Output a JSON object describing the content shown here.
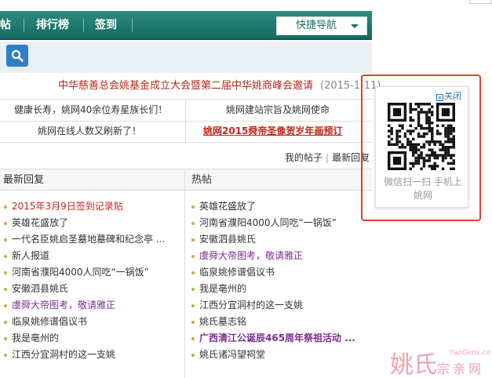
{
  "nav": {
    "items": [
      "帖",
      "排行榜",
      "签到"
    ],
    "quick_nav_label": "快捷导航"
  },
  "announcement": {
    "title": "中华慈善总会姚基金成立大会暨第二届中华姚商峰会邀请",
    "date": "(2015-1-11)"
  },
  "links": {
    "row1_left": "健康长寿，姚网40余位寿星族长们！",
    "row1_right": "姚网建站宗旨及姚网使命",
    "row2_left": "姚网在线人数又刷新了！",
    "row2_right": "姚网2015舜帝圣像贺岁年画预订"
  },
  "tabs": {
    "my_posts": "我的帖子",
    "latest_reply": "最新回复"
  },
  "latest": {
    "header": "最新回复",
    "items": [
      "2015年3月9日签到记录贴",
      "英雄花盛放了",
      "一代名臣姚启圣墓地墓碑和纪念亭 ...",
      "新人报道",
      "河南省濮阳4000人同吃“一锅饭”",
      "安徽泗县姚氏",
      "虞舜大帝图考，敬请雅正",
      "临泉姚修谱倡议书",
      "我是亳州的",
      "江西分宜洞村的这一支姚"
    ]
  },
  "hot": {
    "header": "热帖",
    "items": [
      "英雄花盛放了",
      "河南省濮阳4000人同吃“一锅饭”",
      "安徽泗县姚氏",
      "虞舜大帝图考，敬请雅正",
      "临泉姚修谱倡议书",
      "我是亳州的",
      "江西分宜洞村的这一支姚",
      "姚氏墓志铭",
      "广西清江公诞辰465周年祭祖活动 ...",
      "姚氏诸冯望祠堂"
    ]
  },
  "popup": {
    "close_label": "关闭",
    "caption": "微信扫一扫 手机上姚网"
  },
  "watermark": {
    "big": "姚氏",
    "small": "宗亲网",
    "url": "YaoGens.cn"
  },
  "colors": {
    "nav_bg": "#1f7a70",
    "accent_red": "#c1271b",
    "purple": "#7b2e8e",
    "highlight_border": "#e0412e"
  }
}
